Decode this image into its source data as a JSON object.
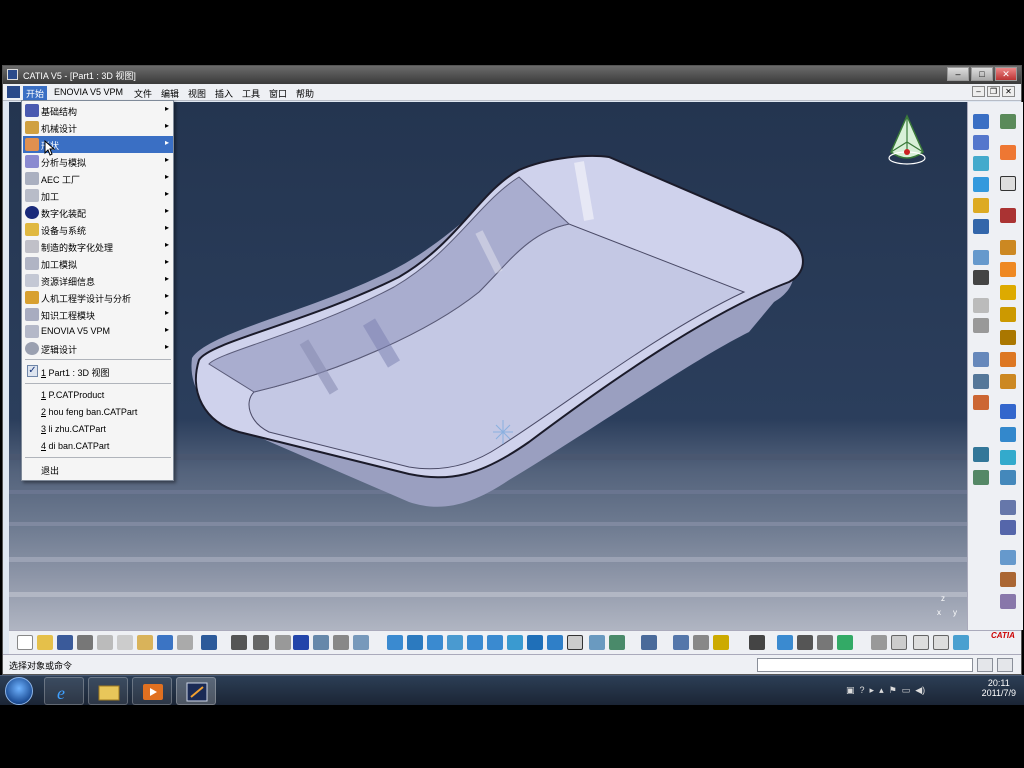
{
  "window": {
    "title": "CATIA V5 - [Part1 : 3D 视图]"
  },
  "menubar": {
    "items": [
      "开始",
      "ENOVIA V5 VPM",
      "文件",
      "编辑",
      "视图",
      "插入",
      "工具",
      "窗口",
      "帮助"
    ]
  },
  "start_menu": {
    "items": [
      {
        "label": "基础结构",
        "submenu": true
      },
      {
        "label": "机械设计",
        "submenu": true
      },
      {
        "label": "形状",
        "submenu": true,
        "highlighted": true
      },
      {
        "label": "分析与模拟",
        "submenu": true
      },
      {
        "label": "AEC 工厂",
        "submenu": true
      },
      {
        "label": "加工",
        "submenu": true
      },
      {
        "label": "数字化装配",
        "submenu": true
      },
      {
        "label": "设备与系统",
        "submenu": true
      },
      {
        "label": "制造的数字化处理",
        "submenu": true
      },
      {
        "label": "加工模拟",
        "submenu": true
      },
      {
        "label": "资源详细信息",
        "submenu": true
      },
      {
        "label": "人机工程学设计与分析",
        "submenu": true
      },
      {
        "label": "知识工程模块",
        "submenu": true
      },
      {
        "label": "ENOVIA V5 VPM",
        "submenu": true
      },
      {
        "label": "逻辑设计",
        "submenu": true
      }
    ],
    "open_window": {
      "num": "1",
      "label": "Part1 : 3D 视图",
      "checked": true
    },
    "recent_files": [
      {
        "num": "1",
        "label": "P.CATProduct"
      },
      {
        "num": "2",
        "label": "hou feng ban.CATPart"
      },
      {
        "num": "3",
        "label": "li zhu.CATPart"
      },
      {
        "num": "4",
        "label": "di ban.CATPart"
      }
    ],
    "exit_label": "退出"
  },
  "status": {
    "message": "选择对象或命令",
    "command_input": ""
  },
  "viewport": {
    "axes_label_x": "x",
    "axes_label_y": "y",
    "axes_label_z": "z",
    "background_top": "#243550",
    "part_color": "#c9cde8"
  },
  "logo": {
    "text": "CATIA"
  },
  "taskbar": {
    "time": "20:11",
    "date": "2011/7/9"
  }
}
